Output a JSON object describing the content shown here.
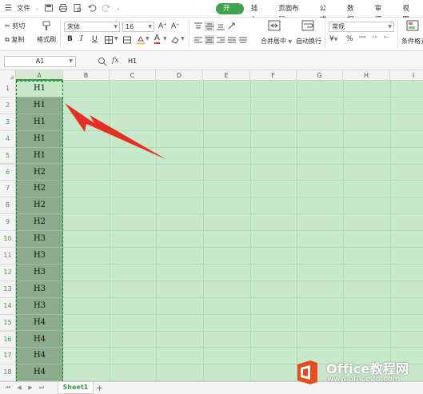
{
  "menubar": {
    "file_label": "文件",
    "tabs": [
      {
        "label": "开始",
        "active": true
      },
      {
        "label": "插入",
        "active": false
      },
      {
        "label": "页面布局",
        "active": false
      },
      {
        "label": "公式",
        "active": false
      },
      {
        "label": "数据",
        "active": false
      },
      {
        "label": "审阅",
        "active": false
      },
      {
        "label": "视图",
        "active": false
      }
    ]
  },
  "ribbon": {
    "cut_label": "剪切",
    "copy_label": "复制",
    "format_painter_label": "格式刷",
    "paste_label": "粘贴",
    "font_name": "宋体",
    "font_size": "16",
    "bold_label": "B",
    "italic_label": "I",
    "underline_label": "U",
    "font_color_label": "A",
    "merge_label": "合并居中",
    "wrap_label": "自动换行",
    "number_format": "常规",
    "currency_label": "¥",
    "percent_label": "%",
    "conditional_label": "条件格式",
    "accent_color": "#3fa34d"
  },
  "formula_bar": {
    "name_box": "A1",
    "fx_label": "fx",
    "content": "H1"
  },
  "columns": [
    "A",
    "B",
    "C",
    "D",
    "E",
    "F",
    "G",
    "H",
    "I"
  ],
  "rows": [
    {
      "num": "1",
      "value": "H1"
    },
    {
      "num": "2",
      "value": "H1"
    },
    {
      "num": "3",
      "value": "H1"
    },
    {
      "num": "4",
      "value": "H1"
    },
    {
      "num": "5",
      "value": "H1"
    },
    {
      "num": "6",
      "value": "H2"
    },
    {
      "num": "7",
      "value": "H2"
    },
    {
      "num": "8",
      "value": "H2"
    },
    {
      "num": "9",
      "value": "H2"
    },
    {
      "num": "10",
      "value": "H3"
    },
    {
      "num": "11",
      "value": "H3"
    },
    {
      "num": "12",
      "value": "H3"
    },
    {
      "num": "13",
      "value": "H3"
    },
    {
      "num": "14",
      "value": "H3"
    },
    {
      "num": "15",
      "value": "H4"
    },
    {
      "num": "16",
      "value": "H4"
    },
    {
      "num": "17",
      "value": "H4"
    },
    {
      "num": "18",
      "value": "H4"
    }
  ],
  "sheetbar": {
    "sheet_name": "Sheet1",
    "add_label": "+"
  },
  "watermark": {
    "title": "Office教程网",
    "url": "www.office26.com"
  }
}
